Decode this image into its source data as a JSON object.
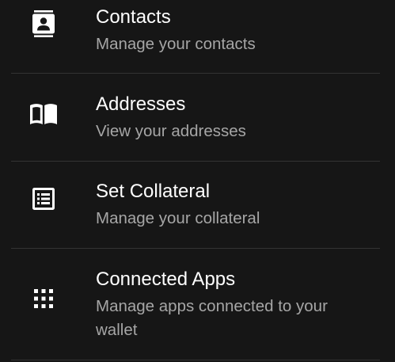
{
  "menu": {
    "items": [
      {
        "title": "Contacts",
        "subtitle": "Manage your contacts",
        "icon": "contacts-icon"
      },
      {
        "title": "Addresses",
        "subtitle": "View your addresses",
        "icon": "book-icon"
      },
      {
        "title": "Set Collateral",
        "subtitle": "Manage your collateral",
        "icon": "list-icon"
      },
      {
        "title": "Connected Apps",
        "subtitle": "Manage apps connected to your wallet",
        "icon": "apps-grid-icon"
      }
    ]
  },
  "colors": {
    "background": "#161616",
    "title": "#ffffff",
    "subtitle": "#a6a6a6",
    "divider": "#333333",
    "icon": "#ffffff"
  }
}
